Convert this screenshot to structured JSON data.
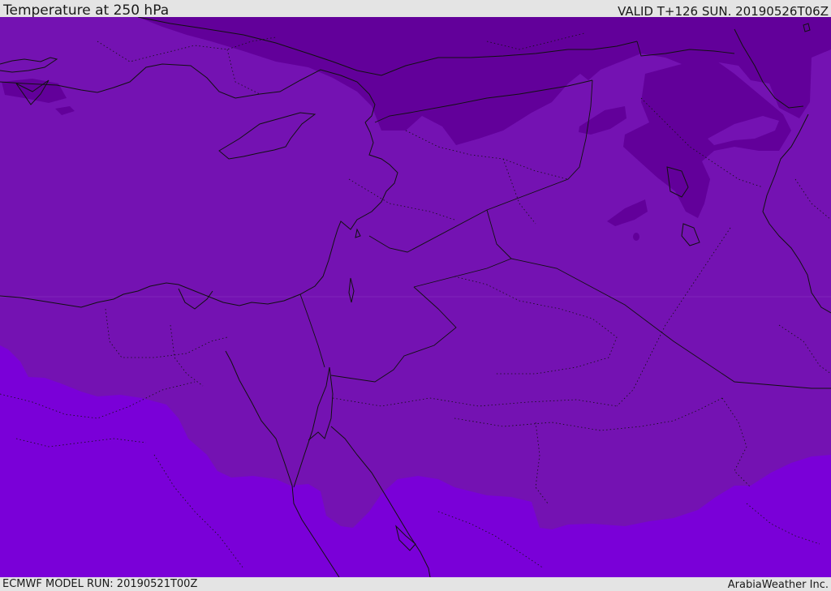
{
  "header": {
    "title": "Temperature at 250 hPa",
    "valid": "VALID T+126 SUN. 20190526T06Z"
  },
  "footer": {
    "model_run": "ECMWF MODEL RUN: 20190521T00Z",
    "credit": "ArabiaWeather Inc."
  },
  "map": {
    "colors": {
      "band_cold": "#62009a",
      "band_mid": "#7412b2",
      "band_warm": "#7a00d8",
      "coast": "#111111",
      "border": "#111111"
    }
  }
}
